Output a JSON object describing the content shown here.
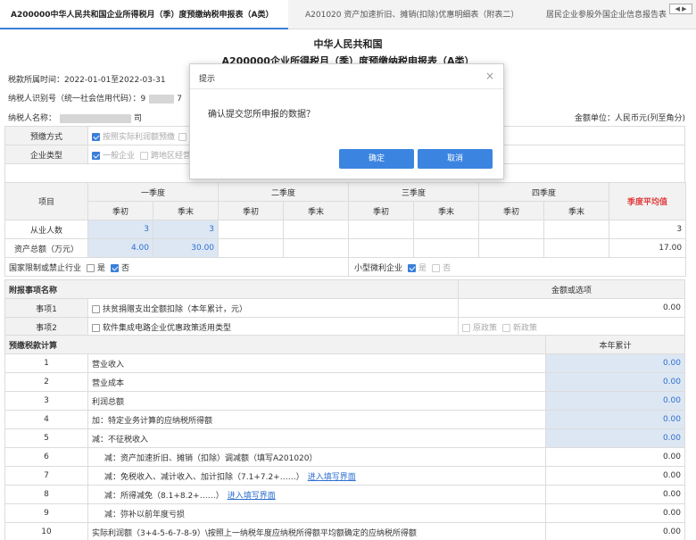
{
  "tabs": [
    "A200000中华人民共和国企业所得税月（季）度预缴纳税申报表（A类）",
    "A201020 资产加速折旧、摊销(扣除)优惠明细表（附表二）",
    "居民企业参股外国企业信息报告表"
  ],
  "tab_scroll": "◀ ▶",
  "title_line1": "中华人民共和国",
  "title_line2": "A200000企业所得税月（季）度预缴纳税申报表（A类）",
  "period": "税款所属时间：2022-01-01至2022-03-31",
  "taxpayer_id_label": "纳税人识别号（统一社会信用代码）：",
  "taxpayer_id_partial_1": "9",
  "taxpayer_id_partial_2": "7",
  "taxpayer_name_label": "纳税人名称：",
  "taxpayer_name_tail": "司",
  "amount_unit": "金额单位：人民币元(列至角分)",
  "prepay_method": {
    "label": "预缴方式",
    "option": "按照实际利润额预缴"
  },
  "enterprise_type": {
    "label": "企业类型",
    "option1": "一般企业",
    "option2": "跨地区经营"
  },
  "quarter_table": {
    "item_label": "项目",
    "quarters": [
      "一季度",
      "二季度",
      "三季度",
      "四季度"
    ],
    "start": "季初",
    "end": "季末",
    "avg": "季度平均值",
    "rows": [
      {
        "label": "从业人数",
        "q1s": "3",
        "q1e": "3",
        "avg": "3"
      },
      {
        "label": "资产总额（万元）",
        "q1s": "4.00",
        "q1e": "30.00",
        "avg": "17.00"
      }
    ],
    "restricted_label": "国家限制或禁止行业",
    "yes": "是",
    "no": "否",
    "small_label": "小型微利企业"
  },
  "attach": {
    "header": "附报事项名称",
    "value_header": "金额或选项",
    "items": [
      {
        "label": "事项1",
        "text": "扶贫捐赠支出全额扣除（本年累计，元）",
        "value": "0.00"
      },
      {
        "label": "事项2",
        "text": "软件集成电路企业优惠政策适用类型",
        "opt1": "原政策",
        "opt2": "新政策"
      }
    ]
  },
  "calc": {
    "header": "预缴税款计算",
    "value_header": "本年累计",
    "rows": [
      {
        "no": "1",
        "text": "营业收入",
        "value": "0.00",
        "indent": 1,
        "editable": true
      },
      {
        "no": "2",
        "text": "营业成本",
        "value": "0.00",
        "indent": 1,
        "editable": true
      },
      {
        "no": "3",
        "text": "利润总额",
        "value": "0.00",
        "indent": 1,
        "editable": true
      },
      {
        "no": "4",
        "text": "加：特定业务计算的应纳税所得额",
        "value": "0.00",
        "indent": 1,
        "editable": true
      },
      {
        "no": "5",
        "text": "减：不征税收入",
        "value": "0.00",
        "indent": 1,
        "editable": true
      },
      {
        "no": "6",
        "text": "减：资产加速折旧、摊销（扣除）调减额（填写A201020）",
        "value": "0.00",
        "indent": 2,
        "editable": false
      },
      {
        "no": "7",
        "text": "减：免税收入、减计收入、加计扣除（7.1+7.2+……）",
        "link": "进入填写界面",
        "value": "0.00",
        "indent": 2,
        "editable": false
      },
      {
        "no": "8",
        "text": "减：所得减免（8.1+8.2+……）",
        "link": "进入填写界面",
        "value": "0.00",
        "indent": 2,
        "editable": false
      },
      {
        "no": "9",
        "text": "减：弥补以前年度亏损",
        "value": "0.00",
        "indent": 2,
        "editable": false
      },
      {
        "no": "10",
        "text": "实际利润额（3+4-5-6-7-8-9）\\按照上一纳税年度应纳税所得额平均额确定的应纳税所得额",
        "value": "0.00",
        "indent": 1,
        "editable": false
      }
    ]
  },
  "modal": {
    "title": "提示",
    "close": "×",
    "message": "确认提交您所申报的数据？",
    "confirm": "确定",
    "cancel": "取消"
  },
  "colors": {
    "accent": "#3b84e0",
    "avg_label": "#e03c3c",
    "editable_bg": "#dde7f3"
  }
}
